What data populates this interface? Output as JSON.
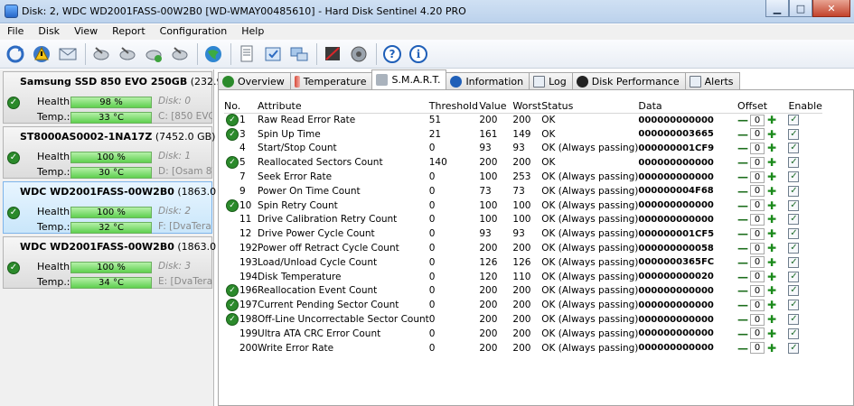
{
  "window": {
    "title": "Disk: 2, WDC WD2001FASS-00W2B0 [WD-WMAY00485610]  -  Hard Disk Sentinel 4.20 PRO"
  },
  "menu": [
    "File",
    "Disk",
    "View",
    "Report",
    "Configuration",
    "Help"
  ],
  "toolbar_icons": [
    "refresh-icon",
    "alert-icon",
    "mail-icon",
    "disk-test-1-icon",
    "disk-test-2-icon",
    "disk-test-3-icon",
    "disk-test-4-icon",
    "web-icon",
    "report-icon",
    "schedule-icon",
    "network-icon",
    "settings-icon",
    "sound-icon",
    "help-icon",
    "info-icon"
  ],
  "disks": [
    {
      "name": "Samsung SSD 850 EVO 250GB",
      "size": "(232.9 GB)",
      "health_label": "Health:",
      "health": "98 %",
      "health_pct": 98,
      "temp_label": "Temp.:",
      "temp": "33 °C",
      "disk": "Disk: 0",
      "vol": "C: [850 EVO]"
    },
    {
      "name": "ST8000AS0002-1NA17Z",
      "size": "(7452.0 GB)",
      "health_label": "Health:",
      "health": "100 %",
      "health_pct": 100,
      "temp_label": "Temp.:",
      "temp": "30 °C",
      "disk": "Disk: 1",
      "vol": "D: [Osam 8TB]"
    },
    {
      "name": "WDC WD2001FASS-00W2B0",
      "size": "(1863.0 GB)",
      "health_label": "Health:",
      "health": "100 %",
      "health_pct": 100,
      "temp_label": "Temp.:",
      "temp": "32 °C",
      "disk": "Disk: 2",
      "vol": "F: [DvaTera1]"
    },
    {
      "name": "WDC WD2001FASS-00W2B0",
      "size": "(1863.0 GB)",
      "health_label": "Health:",
      "health": "100 %",
      "health_pct": 100,
      "temp_label": "Temp.:",
      "temp": "34 °C",
      "disk": "Disk: 3",
      "vol": "E: [DvaTera2]"
    }
  ],
  "tabs": [
    "Overview",
    "Temperature",
    "S.M.A.R.T.",
    "Information",
    "Log",
    "Disk Performance",
    "Alerts"
  ],
  "active_tab": "S.M.A.R.T.",
  "smart": {
    "columns": [
      "No.",
      "Attribute",
      "Threshold",
      "Value",
      "Worst",
      "Status",
      "Data",
      "Offset",
      "Enable"
    ],
    "rows": [
      {
        "icon": true,
        "no": "1",
        "attr": "Raw Read Error Rate",
        "thr": "51",
        "val": "200",
        "worst": "200",
        "status": "OK",
        "data": "000000000000",
        "offset": "0"
      },
      {
        "icon": true,
        "no": "3",
        "attr": "Spin Up Time",
        "thr": "21",
        "val": "161",
        "worst": "149",
        "status": "OK",
        "data": "000000003665",
        "offset": "0"
      },
      {
        "icon": false,
        "no": "4",
        "attr": "Start/Stop Count",
        "thr": "0",
        "val": "93",
        "worst": "93",
        "status": "OK (Always passing)",
        "data": "000000001CF9",
        "offset": "0"
      },
      {
        "icon": true,
        "no": "5",
        "attr": "Reallocated Sectors Count",
        "thr": "140",
        "val": "200",
        "worst": "200",
        "status": "OK",
        "data": "000000000000",
        "offset": "0"
      },
      {
        "icon": false,
        "no": "7",
        "attr": "Seek Error Rate",
        "thr": "0",
        "val": "100",
        "worst": "253",
        "status": "OK (Always passing)",
        "data": "000000000000",
        "offset": "0"
      },
      {
        "icon": false,
        "no": "9",
        "attr": "Power On Time Count",
        "thr": "0",
        "val": "73",
        "worst": "73",
        "status": "OK (Always passing)",
        "data": "000000004F68",
        "offset": "0"
      },
      {
        "icon": true,
        "no": "10",
        "attr": "Spin Retry Count",
        "thr": "0",
        "val": "100",
        "worst": "100",
        "status": "OK (Always passing)",
        "data": "000000000000",
        "offset": "0"
      },
      {
        "icon": false,
        "no": "11",
        "attr": "Drive Calibration Retry Count",
        "thr": "0",
        "val": "100",
        "worst": "100",
        "status": "OK (Always passing)",
        "data": "000000000000",
        "offset": "0"
      },
      {
        "icon": false,
        "no": "12",
        "attr": "Drive Power Cycle Count",
        "thr": "0",
        "val": "93",
        "worst": "93",
        "status": "OK (Always passing)",
        "data": "000000001CF5",
        "offset": "0"
      },
      {
        "icon": false,
        "no": "192",
        "attr": "Power off Retract Cycle Count",
        "thr": "0",
        "val": "200",
        "worst": "200",
        "status": "OK (Always passing)",
        "data": "000000000058",
        "offset": "0"
      },
      {
        "icon": false,
        "no": "193",
        "attr": "Load/Unload Cycle Count",
        "thr": "0",
        "val": "126",
        "worst": "126",
        "status": "OK (Always passing)",
        "data": "0000000365FC",
        "offset": "0"
      },
      {
        "icon": false,
        "no": "194",
        "attr": "Disk Temperature",
        "thr": "0",
        "val": "120",
        "worst": "110",
        "status": "OK (Always passing)",
        "data": "000000000020",
        "offset": "0"
      },
      {
        "icon": true,
        "no": "196",
        "attr": "Reallocation Event Count",
        "thr": "0",
        "val": "200",
        "worst": "200",
        "status": "OK (Always passing)",
        "data": "000000000000",
        "offset": "0"
      },
      {
        "icon": true,
        "no": "197",
        "attr": "Current Pending Sector Count",
        "thr": "0",
        "val": "200",
        "worst": "200",
        "status": "OK (Always passing)",
        "data": "000000000000",
        "offset": "0"
      },
      {
        "icon": true,
        "no": "198",
        "attr": "Off-Line Uncorrectable Sector Count",
        "thr": "0",
        "val": "200",
        "worst": "200",
        "status": "OK (Always passing)",
        "data": "000000000000",
        "offset": "0"
      },
      {
        "icon": false,
        "no": "199",
        "attr": "Ultra ATA CRC Error Count",
        "thr": "0",
        "val": "200",
        "worst": "200",
        "status": "OK (Always passing)",
        "data": "000000000000",
        "offset": "0"
      },
      {
        "icon": false,
        "no": "200",
        "attr": "Write Error Rate",
        "thr": "0",
        "val": "200",
        "worst": "200",
        "status": "OK (Always passing)",
        "data": "000000000000",
        "offset": "0"
      }
    ]
  }
}
